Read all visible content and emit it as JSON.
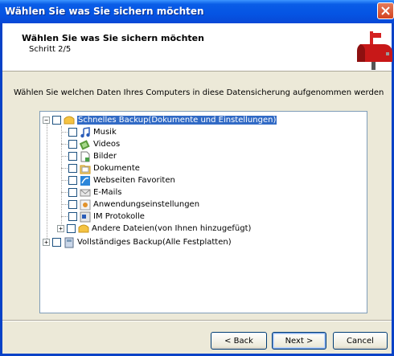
{
  "window": {
    "title": "Wählen Sie was Sie sichern möchten"
  },
  "header": {
    "title": "Wählen Sie was Sie sichern möchten",
    "step": "Schritt 2/5",
    "icon": "mailbox-icon"
  },
  "description": "Wählen Sie welchen Daten Ihres Computers in diese Datensicherung aufgenommen werden",
  "tree": {
    "root_quick": {
      "label": "Schnelles Backup(Dokumente und Einstellungen)",
      "icon": "folder-icon",
      "expanded": true,
      "selected": true
    },
    "children": [
      {
        "label": "Musik",
        "icon": "music-icon"
      },
      {
        "label": "Videos",
        "icon": "video-icon"
      },
      {
        "label": "Bilder",
        "icon": "image-icon"
      },
      {
        "label": "Dokumente",
        "icon": "document-icon"
      },
      {
        "label": "Webseiten Favoriten",
        "icon": "browser-icon"
      },
      {
        "label": "E-Mails",
        "icon": "mail-icon"
      },
      {
        "label": "Anwendungseinstellungen",
        "icon": "settings-icon"
      },
      {
        "label": "IM Protokolle",
        "icon": "chat-icon"
      },
      {
        "label": "Andere Dateien(von Ihnen hinzugefügt)",
        "icon": "folder-icon",
        "expandable": true
      }
    ],
    "root_full": {
      "label": "Vollständiges Backup(Alle Festplatten)",
      "icon": "drive-icon",
      "expanded": false
    }
  },
  "buttons": {
    "back": "< Back",
    "next": "Next >",
    "cancel": "Cancel"
  },
  "colors": {
    "titlebar": "#0554e3",
    "selection": "#316ac5",
    "dialog_bg": "#ece9d8"
  }
}
